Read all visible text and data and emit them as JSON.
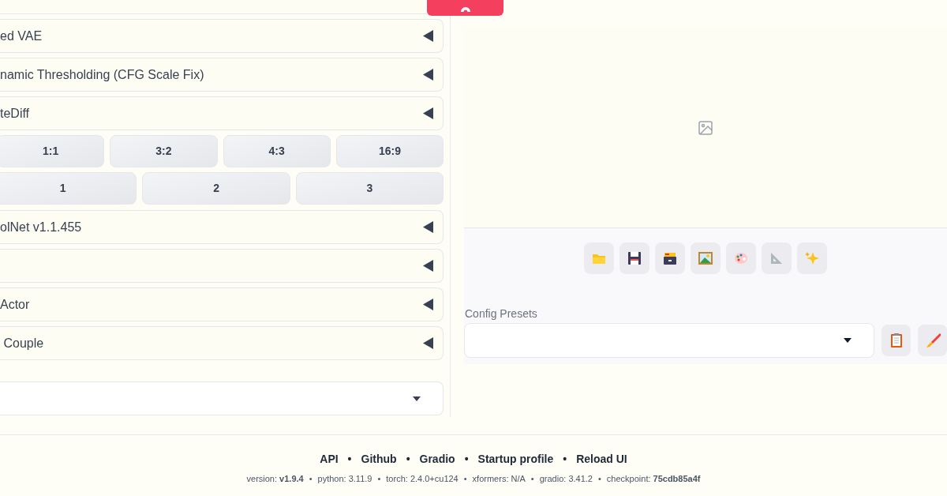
{
  "accordions_top": [
    {
      "label": "ed VAE",
      "expanded": false
    },
    {
      "label": "namic Thresholding (CFG Scale Fix)",
      "expanded": false
    },
    {
      "label": "teDiff",
      "expanded": false
    }
  ],
  "ratio_buttons": [
    "1:1",
    "3:2",
    "4:3",
    "16:9"
  ],
  "count_buttons": [
    "1",
    "2",
    "3"
  ],
  "accordions_bottom": [
    {
      "label": "olNet v1.1.455",
      "expanded": false
    },
    {
      "expanded": false
    },
    {
      "label": "Actor",
      "expanded": false
    },
    {
      "label": " Couple",
      "expanded": false
    }
  ],
  "image_toolbar": [
    {
      "kind": "folder"
    },
    {
      "kind": "floppy"
    },
    {
      "kind": "cardbox"
    },
    {
      "kind": "picture"
    },
    {
      "kind": "palette"
    },
    {
      "kind": "ruler"
    },
    {
      "kind": "sparkles"
    }
  ],
  "config_presets": {
    "label": "Config Presets",
    "buttons": [
      {
        "kind": "clipboard"
      },
      {
        "kind": "brush"
      }
    ]
  },
  "footer": {
    "links": [
      "API",
      "Github",
      "Gradio",
      "Startup profile",
      "Reload UI"
    ],
    "separator": "•",
    "versions": [
      "version: **v1.9.4**",
      "python: 3.11.9",
      "torch: 2.4.0+cu124",
      "xformers: N/A",
      "gradio: 3.41.2",
      "checkpoint: **75cdb85a4f**"
    ]
  }
}
